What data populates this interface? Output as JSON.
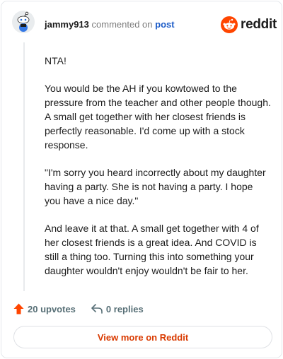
{
  "header": {
    "username": "jammy913",
    "action_text": "commented on",
    "post_link": "post"
  },
  "brand": {
    "wordmark": "reddit",
    "color": "#ff4500"
  },
  "comment": {
    "paragraphs": [
      "NTA!",
      "You would be the AH if you kowtowed to the pressure from the teacher and other people though. A small get together with her closest friends is perfectly reasonable. I'd come up with a stock response.",
      "\"I'm sorry you heard incorrectly about my daughter having a party. She is not having a party. I hope you have a nice day.\"",
      "And leave it at that. A small get together with 4 of her closest friends is a great idea. And COVID is still a thing too. Turning this into something your daughter wouldn't enjoy wouldn't be fair to her."
    ]
  },
  "actions": {
    "upvotes_label": "20 upvotes",
    "replies_label": "0 replies"
  },
  "footer": {
    "view_more_label": "View more on Reddit"
  },
  "icons": {
    "avatar": "snoo-avatar-icon",
    "brand": "reddit-logo-icon",
    "upvote": "upvote-arrow-icon",
    "reply": "reply-arrow-icon"
  }
}
